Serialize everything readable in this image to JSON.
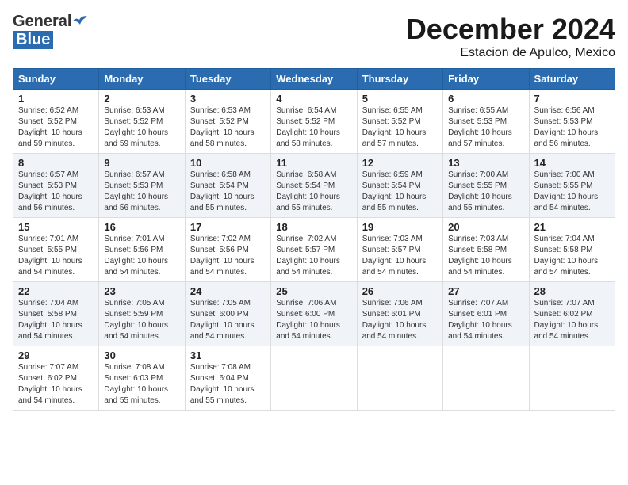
{
  "header": {
    "logo_general": "General",
    "logo_blue": "Blue",
    "month": "December 2024",
    "location": "Estacion de Apulco, Mexico"
  },
  "days_of_week": [
    "Sunday",
    "Monday",
    "Tuesday",
    "Wednesday",
    "Thursday",
    "Friday",
    "Saturday"
  ],
  "weeks": [
    [
      {
        "day": "1",
        "info": "Sunrise: 6:52 AM\nSunset: 5:52 PM\nDaylight: 10 hours\nand 59 minutes."
      },
      {
        "day": "2",
        "info": "Sunrise: 6:53 AM\nSunset: 5:52 PM\nDaylight: 10 hours\nand 59 minutes."
      },
      {
        "day": "3",
        "info": "Sunrise: 6:53 AM\nSunset: 5:52 PM\nDaylight: 10 hours\nand 58 minutes."
      },
      {
        "day": "4",
        "info": "Sunrise: 6:54 AM\nSunset: 5:52 PM\nDaylight: 10 hours\nand 58 minutes."
      },
      {
        "day": "5",
        "info": "Sunrise: 6:55 AM\nSunset: 5:52 PM\nDaylight: 10 hours\nand 57 minutes."
      },
      {
        "day": "6",
        "info": "Sunrise: 6:55 AM\nSunset: 5:53 PM\nDaylight: 10 hours\nand 57 minutes."
      },
      {
        "day": "7",
        "info": "Sunrise: 6:56 AM\nSunset: 5:53 PM\nDaylight: 10 hours\nand 56 minutes."
      }
    ],
    [
      {
        "day": "8",
        "info": "Sunrise: 6:57 AM\nSunset: 5:53 PM\nDaylight: 10 hours\nand 56 minutes."
      },
      {
        "day": "9",
        "info": "Sunrise: 6:57 AM\nSunset: 5:53 PM\nDaylight: 10 hours\nand 56 minutes."
      },
      {
        "day": "10",
        "info": "Sunrise: 6:58 AM\nSunset: 5:54 PM\nDaylight: 10 hours\nand 55 minutes."
      },
      {
        "day": "11",
        "info": "Sunrise: 6:58 AM\nSunset: 5:54 PM\nDaylight: 10 hours\nand 55 minutes."
      },
      {
        "day": "12",
        "info": "Sunrise: 6:59 AM\nSunset: 5:54 PM\nDaylight: 10 hours\nand 55 minutes."
      },
      {
        "day": "13",
        "info": "Sunrise: 7:00 AM\nSunset: 5:55 PM\nDaylight: 10 hours\nand 55 minutes."
      },
      {
        "day": "14",
        "info": "Sunrise: 7:00 AM\nSunset: 5:55 PM\nDaylight: 10 hours\nand 54 minutes."
      }
    ],
    [
      {
        "day": "15",
        "info": "Sunrise: 7:01 AM\nSunset: 5:55 PM\nDaylight: 10 hours\nand 54 minutes."
      },
      {
        "day": "16",
        "info": "Sunrise: 7:01 AM\nSunset: 5:56 PM\nDaylight: 10 hours\nand 54 minutes."
      },
      {
        "day": "17",
        "info": "Sunrise: 7:02 AM\nSunset: 5:56 PM\nDaylight: 10 hours\nand 54 minutes."
      },
      {
        "day": "18",
        "info": "Sunrise: 7:02 AM\nSunset: 5:57 PM\nDaylight: 10 hours\nand 54 minutes."
      },
      {
        "day": "19",
        "info": "Sunrise: 7:03 AM\nSunset: 5:57 PM\nDaylight: 10 hours\nand 54 minutes."
      },
      {
        "day": "20",
        "info": "Sunrise: 7:03 AM\nSunset: 5:58 PM\nDaylight: 10 hours\nand 54 minutes."
      },
      {
        "day": "21",
        "info": "Sunrise: 7:04 AM\nSunset: 5:58 PM\nDaylight: 10 hours\nand 54 minutes."
      }
    ],
    [
      {
        "day": "22",
        "info": "Sunrise: 7:04 AM\nSunset: 5:58 PM\nDaylight: 10 hours\nand 54 minutes."
      },
      {
        "day": "23",
        "info": "Sunrise: 7:05 AM\nSunset: 5:59 PM\nDaylight: 10 hours\nand 54 minutes."
      },
      {
        "day": "24",
        "info": "Sunrise: 7:05 AM\nSunset: 6:00 PM\nDaylight: 10 hours\nand 54 minutes."
      },
      {
        "day": "25",
        "info": "Sunrise: 7:06 AM\nSunset: 6:00 PM\nDaylight: 10 hours\nand 54 minutes."
      },
      {
        "day": "26",
        "info": "Sunrise: 7:06 AM\nSunset: 6:01 PM\nDaylight: 10 hours\nand 54 minutes."
      },
      {
        "day": "27",
        "info": "Sunrise: 7:07 AM\nSunset: 6:01 PM\nDaylight: 10 hours\nand 54 minutes."
      },
      {
        "day": "28",
        "info": "Sunrise: 7:07 AM\nSunset: 6:02 PM\nDaylight: 10 hours\nand 54 minutes."
      }
    ],
    [
      {
        "day": "29",
        "info": "Sunrise: 7:07 AM\nSunset: 6:02 PM\nDaylight: 10 hours\nand 54 minutes."
      },
      {
        "day": "30",
        "info": "Sunrise: 7:08 AM\nSunset: 6:03 PM\nDaylight: 10 hours\nand 55 minutes."
      },
      {
        "day": "31",
        "info": "Sunrise: 7:08 AM\nSunset: 6:04 PM\nDaylight: 10 hours\nand 55 minutes."
      },
      {
        "day": "",
        "info": ""
      },
      {
        "day": "",
        "info": ""
      },
      {
        "day": "",
        "info": ""
      },
      {
        "day": "",
        "info": ""
      }
    ]
  ]
}
